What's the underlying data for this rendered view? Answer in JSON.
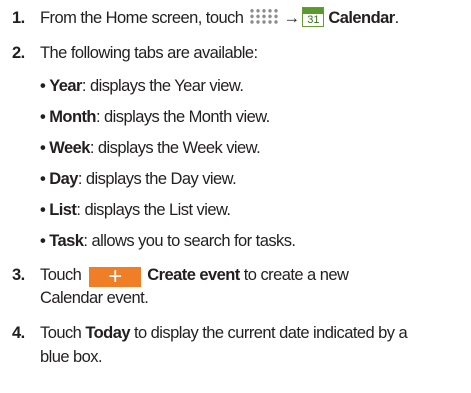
{
  "steps": [
    {
      "number": "1.",
      "prefix": "From the Home screen, touch",
      "arrow": "→",
      "calendar_day": "31",
      "app_name": "Calendar",
      "suffix": "."
    },
    {
      "number": "2.",
      "text": "The following tabs are available:",
      "tabs": [
        {
          "bullet": "•",
          "name": "Year",
          "desc": ": displays the Year view."
        },
        {
          "bullet": "•",
          "name": "Month",
          "desc": ": displays the Month view."
        },
        {
          "bullet": "•",
          "name": "Week",
          "desc": ": displays the Week view."
        },
        {
          "bullet": "•",
          "name": "Day",
          "desc": ": displays the Day view."
        },
        {
          "bullet": "•",
          "name": "List",
          "desc": ": displays the List view."
        },
        {
          "bullet": "•",
          "name": "Task",
          "desc": ": allows you to search for tasks."
        }
      ]
    },
    {
      "number": "3.",
      "prefix": "Touch",
      "button_glyph": "+",
      "button_label": "Create event",
      "suffix_line1": " to create a new",
      "line2": "Calendar event."
    },
    {
      "number": "4.",
      "prefix": "Touch ",
      "bold": "Today",
      "suffix_line1": " to display the current date indicated by a",
      "line2": "blue box."
    }
  ],
  "colors": {
    "text": "#231f20",
    "create_button": "#f07e26",
    "calendar_icon": "#5a9a2c",
    "apps_icon": "#8c8c8c"
  },
  "icons": [
    "apps-grid-icon",
    "right-arrow-icon",
    "calendar-app-icon",
    "plus-icon"
  ]
}
